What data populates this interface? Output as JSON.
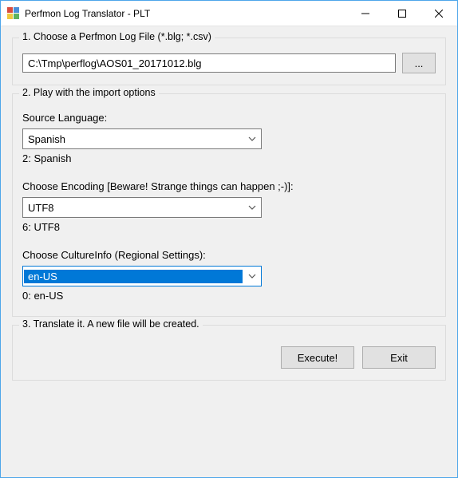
{
  "window": {
    "title": "Perfmon Log Translator - PLT"
  },
  "step1": {
    "legend": "1. Choose a Perfmon Log File (*.blg; *.csv)",
    "filepath": "C:\\Tmp\\perflog\\AOS01_20171012.blg",
    "browse_label": "..."
  },
  "step2": {
    "legend": "2. Play with the import options",
    "language": {
      "label": "Source Language:",
      "value": "Spanish",
      "info": "2: Spanish"
    },
    "encoding": {
      "label": "Choose Encoding [Beware! Strange things can happen ;-)]:",
      "value": "UTF8",
      "info": "6: UTF8"
    },
    "culture": {
      "label": "Choose CultureInfo (Regional Settings):",
      "value": "en-US",
      "info": "0: en-US"
    }
  },
  "step3": {
    "legend": "3. Translate it. A new file will be created.",
    "execute_label": "Execute!",
    "exit_label": "Exit"
  }
}
